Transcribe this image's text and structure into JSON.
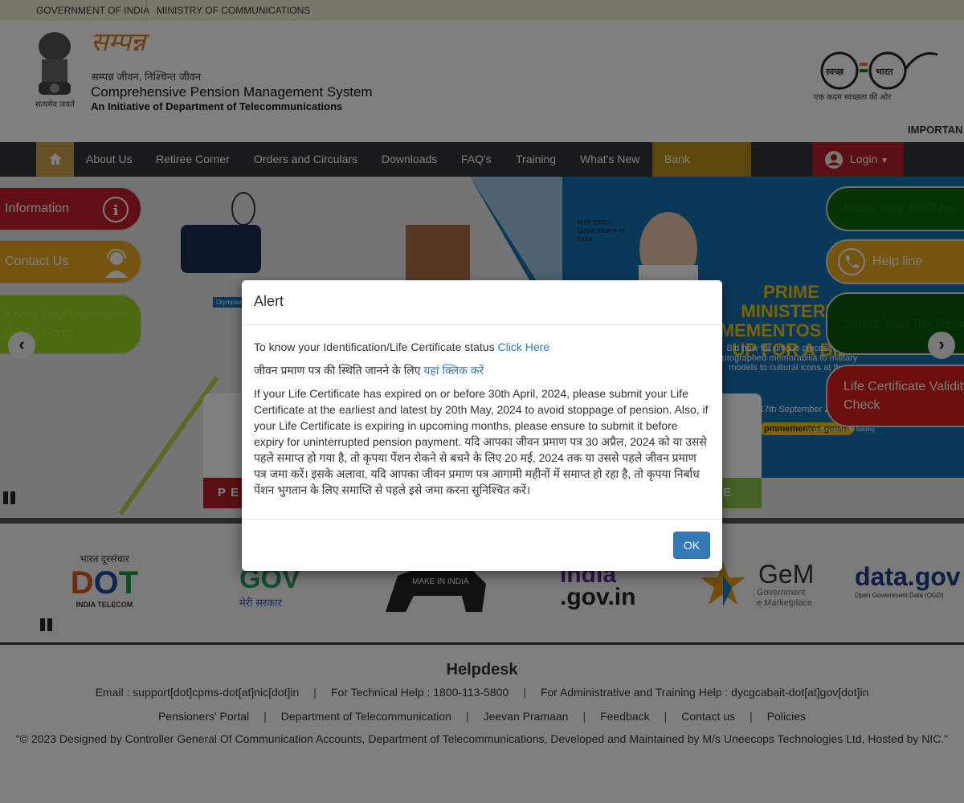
{
  "topbar": {
    "gov": "GOVERNMENT OF INDIA",
    "ministry": "MINISTRY OF COMMUNICATIONS"
  },
  "header": {
    "logo_text": "सम्पन्न",
    "emblem_motto": "सत्यमेव जयते",
    "tagline_hindi": "सम्पन्न जीवन, निश्चिन्त जीवन",
    "title": "Comprehensive Pension Management System",
    "subtitle": "An Initiative of Department of Telecommunications",
    "swachh_left": "स्वच्छ",
    "swachh_right": "भारत",
    "swachh_caption": "एक कदम स्वच्छता की ओर",
    "marquee": "IMPORTAN"
  },
  "nav": {
    "items": [
      "About Us",
      "Retiree Corner",
      "Orders and Circulars",
      "Downloads",
      "FAQ's",
      "Training",
      "What's New",
      "Bank Migration"
    ],
    "login": "Login",
    "colors": {
      "home": "#c9a24c",
      "bank_migration": "#b8901a",
      "login": "#b52025"
    }
  },
  "banner": {
    "left_buttons": [
      "Information",
      "Contact Us",
      "Know Your Pensioner (KYP) Form"
    ],
    "right_buttons": [
      "Know Your PPO No",
      "Help line",
      "Select Your Tax Regime",
      "Life Certificate Validity Check"
    ],
    "slide": {
      "govt_hindi": "भारत सरकार",
      "govt": "Government of India",
      "headline": "PRIME MINISTER'S MEMENTOS ARE UP FOR A BID",
      "sub": "Bid now for unique pieces from autographed memorabilia to military models to cultural icons at the",
      "dates": "17th September 2021 to 7th October",
      "site": "pmmementos.gov.in",
      "participate": "to participate in the bidding",
      "caption": "Olympian Badminton"
    },
    "card_left": "PE",
    "card_right": "E"
  },
  "logos": [
    "भारत दूरसंचार DOT INDIA TELECOM",
    "MyGov मेरी सरकार",
    "MAKE IN INDIA",
    "india.gov.in",
    "GeM Government e Marketplace",
    "data.gov Open Government Data"
  ],
  "footer": {
    "title": "Helpdesk",
    "email": "Email : support[dot]cpms-dot[at]nic[dot]in",
    "tech": "For Technical Help : 1800-113-5800",
    "admin": "For Administrative and Training Help : dycgcabait-dot[at]gov[dot]in",
    "links": [
      "Pensioners' Portal",
      "Department of Telecommunication",
      "Jeevan Pramaan",
      "Feedback",
      "Contact us",
      "Policies"
    ],
    "copyright": "\"© 2023 Designed by Controller General Of Communication Accounts, Department of Telecommunications, Developed and Maintained by M/s Uneecops Technologies Ltd, Hosted by NIC.\""
  },
  "modal": {
    "title": "Alert",
    "line1": "To know your Identification/Life Certificate status ",
    "line1_link": "Click Here",
    "line2": "जीवन प्रमाण पत्र की स्थिति जानने के लिए ",
    "line2_link": "यहां क्लिक करें",
    "body": "If your Life Certificate has expired on or before 30th April, 2024, please submit your Life Certificate at the earliest and latest by 20th May, 2024 to avoid stoppage of pension. Also, if your Life Certificate is expiring in upcoming months, please ensure to submit it before expiry for uninterrupted pension payment. यदि आपका जीवन प्रमाण पत्र 30 अप्रैल, 2024 को या उससे पहले समाप्त हो गया है, तो कृपया पेंशन रोकने से बचने के लिए 20 मई, 2024 तक या उससे पहले जीवन प्रमाण पत्र जमा करें। इसके अलावा, यदि आपका जीवन प्रमाण पत्र आगामी महीनों में समाप्त हो रहा है, तो कृपया निर्बाध पेंशन भुगतान के लिए समाप्ति से पहले इसे जमा करना सुनिश्चित करें।",
    "ok": "OK"
  }
}
